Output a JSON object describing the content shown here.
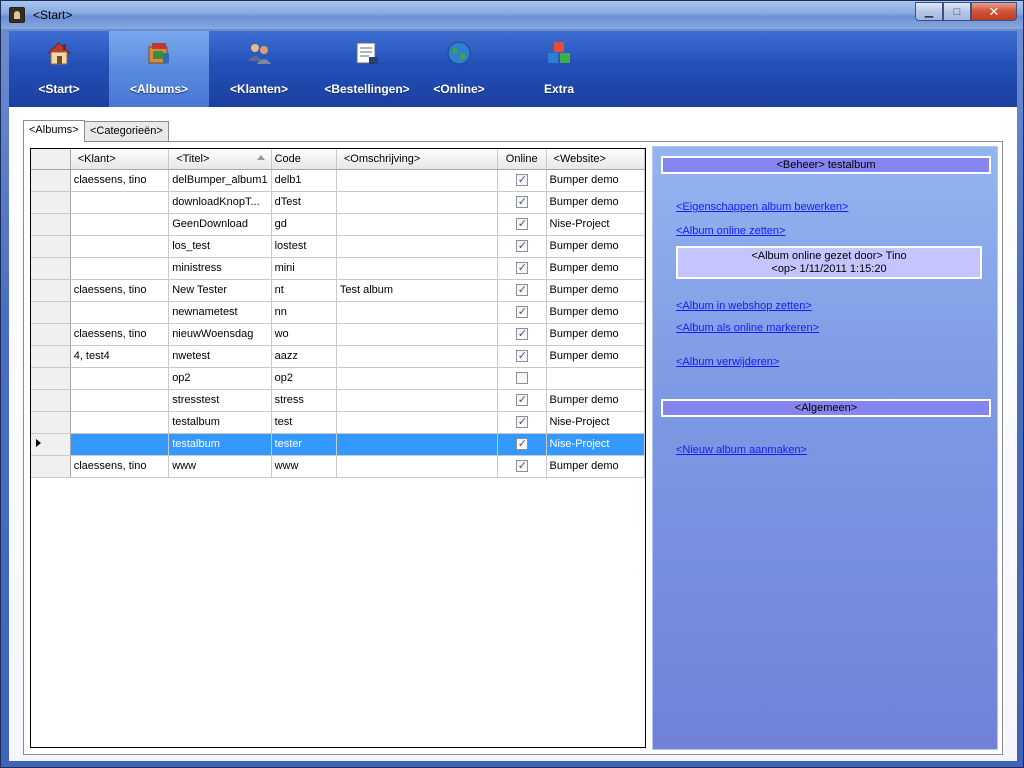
{
  "window": {
    "title": "<Start>"
  },
  "menu": [
    {
      "label": "<Start>",
      "icon": "home-icon",
      "active": false
    },
    {
      "label": "<Albums>",
      "icon": "albums-icon",
      "active": true
    },
    {
      "label": "<Klanten>",
      "icon": "customers-icon",
      "active": false
    },
    {
      "label": "<Bestellingen>",
      "icon": "orders-icon",
      "active": false
    },
    {
      "label": "<Online>",
      "icon": "globe-icon",
      "active": false
    },
    {
      "label": "Extra",
      "icon": "blocks-icon",
      "active": false
    }
  ],
  "tabs": [
    {
      "label": "<Albums>",
      "active": true
    },
    {
      "label": "<Categorieën>",
      "active": false
    }
  ],
  "grid": {
    "columns": [
      "<Klant>",
      "<Titel>",
      "Code",
      "<Omschrijving>",
      "Online",
      "<Website>"
    ],
    "rows": [
      {
        "klant": "claessens, tino",
        "titel": "delBumper_album1",
        "code": "delb1",
        "omschrijving": "",
        "online": true,
        "website": "Bumper demo"
      },
      {
        "klant": "",
        "titel": "downloadKnopT...",
        "code": "dTest",
        "omschrijving": "",
        "online": true,
        "website": "Bumper demo"
      },
      {
        "klant": "",
        "titel": "GeenDownload",
        "code": "gd",
        "omschrijving": "",
        "online": true,
        "website": "Nise-Project"
      },
      {
        "klant": "",
        "titel": "los_test",
        "code": "lostest",
        "omschrijving": "",
        "online": true,
        "website": "Bumper demo"
      },
      {
        "klant": "",
        "titel": "ministress",
        "code": "mini",
        "omschrijving": "",
        "online": true,
        "website": "Bumper demo"
      },
      {
        "klant": "claessens, tino",
        "titel": "New Tester",
        "code": "nt",
        "omschrijving": "Test album",
        "online": true,
        "website": "Bumper demo"
      },
      {
        "klant": "",
        "titel": "newnametest",
        "code": "nn",
        "omschrijving": "",
        "online": true,
        "website": "Bumper demo"
      },
      {
        "klant": "claessens, tino",
        "titel": "nieuwWoensdag",
        "code": "wo",
        "omschrijving": "",
        "online": true,
        "website": "Bumper demo"
      },
      {
        "klant": "4, test4",
        "titel": "nwetest",
        "code": "aazz",
        "omschrijving": "",
        "online": true,
        "website": "Bumper demo"
      },
      {
        "klant": "",
        "titel": "op2",
        "code": "op2",
        "omschrijving": "",
        "online": false,
        "website": ""
      },
      {
        "klant": "",
        "titel": "stresstest",
        "code": "stress",
        "omschrijving": "",
        "online": true,
        "website": "Bumper demo"
      },
      {
        "klant": "",
        "titel": "testalbum",
        "code": "test",
        "omschrijving": "",
        "online": true,
        "website": "Nise-Project"
      },
      {
        "klant": "",
        "titel": "testalbum",
        "code": "tester",
        "omschrijving": "",
        "online": true,
        "website": "Nise-Project",
        "selected": true
      },
      {
        "klant": "claessens, tino",
        "titel": "www",
        "code": "www",
        "omschrijving": "",
        "online": true,
        "website": "Bumper demo"
      }
    ]
  },
  "side": {
    "beheer_header": "<Beheer> testalbum",
    "links_top": [
      "<Eigenschappen album bewerken>",
      "<Album online zetten>"
    ],
    "info_line1": "<Album online gezet door> Tino",
    "info_line2": "<op> 1/11/2011 1:15:20",
    "links_mid": [
      "<Album in webshop zetten>",
      "<Album als online markeren>",
      "<Album verwijderen>"
    ],
    "algemeen_header": "<Algemeen>",
    "links_bottom": [
      "<Nieuw album aanmaken>"
    ]
  },
  "colors": {
    "menubar": "#2350b8",
    "active_menu": "#5b8be0",
    "selection": "#3399ff",
    "side_header": "#8585f0",
    "link": "#1a1aff"
  }
}
